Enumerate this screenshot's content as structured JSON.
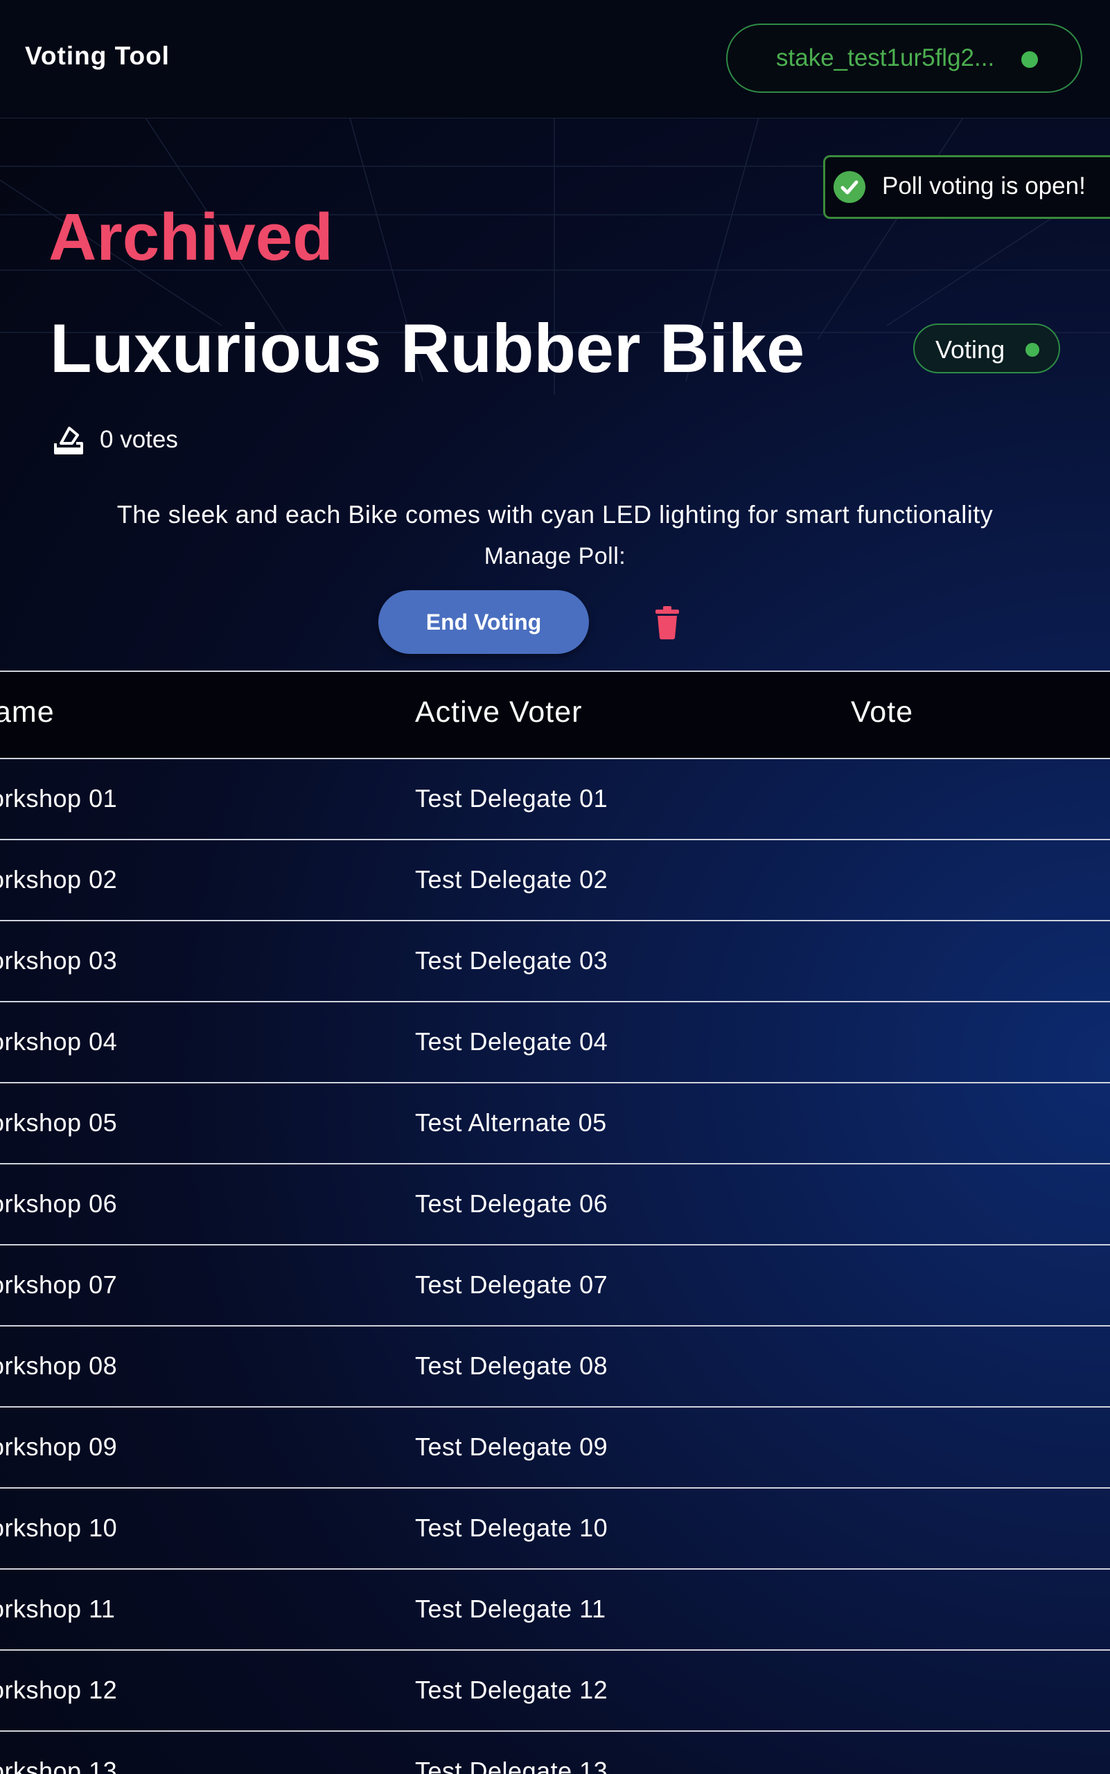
{
  "header": {
    "app_title": "Voting Tool",
    "wallet_address": "stake_test1ur5flg2...",
    "wallet_status_color": "#43b552"
  },
  "toast": {
    "message": "Poll voting is open!",
    "icon": "check-circle-icon"
  },
  "poll": {
    "archived_label": "Archived",
    "title": "Luxurious Rubber Bike",
    "status": "Voting",
    "votes_text": "0 votes",
    "votes_icon": "ballot-box-icon",
    "description": "The sleek and each Bike comes with cyan LED lighting for smart functionality",
    "manage_label": "Manage Poll:",
    "end_voting_label": "End Voting",
    "delete_icon": "trash-icon"
  },
  "colors": {
    "accent_pink": "#ef4a69",
    "accent_green": "#43b552",
    "button_blue": "#4a6fc0"
  },
  "table": {
    "headers": {
      "name": "ame",
      "voter": "Active Voter",
      "vote": "Vote"
    },
    "rows": [
      {
        "name": "orkshop 01",
        "voter": "Test Delegate 01",
        "vote": ""
      },
      {
        "name": "orkshop 02",
        "voter": "Test Delegate 02",
        "vote": ""
      },
      {
        "name": "orkshop 03",
        "voter": "Test Delegate 03",
        "vote": ""
      },
      {
        "name": "orkshop 04",
        "voter": "Test Delegate 04",
        "vote": ""
      },
      {
        "name": "orkshop 05",
        "voter": "Test Alternate 05",
        "vote": ""
      },
      {
        "name": "orkshop 06",
        "voter": "Test Delegate 06",
        "vote": ""
      },
      {
        "name": "orkshop 07",
        "voter": "Test Delegate 07",
        "vote": ""
      },
      {
        "name": "orkshop 08",
        "voter": "Test Delegate 08",
        "vote": ""
      },
      {
        "name": "orkshop 09",
        "voter": "Test Delegate 09",
        "vote": ""
      },
      {
        "name": "orkshop 10",
        "voter": "Test Delegate 10",
        "vote": ""
      },
      {
        "name": "orkshop 11",
        "voter": "Test Delegate 11",
        "vote": ""
      },
      {
        "name": "orkshop 12",
        "voter": "Test Delegate 12",
        "vote": ""
      },
      {
        "name": "orkshop 13",
        "voter": "Test Delegate 13",
        "vote": ""
      }
    ]
  }
}
